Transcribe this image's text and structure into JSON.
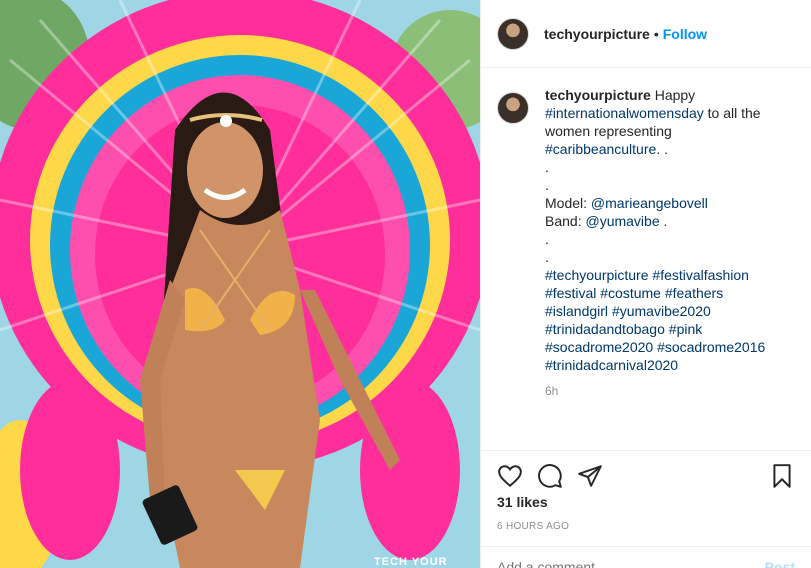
{
  "header": {
    "username": "techyourpicture",
    "dot": "•",
    "follow_label": "Follow"
  },
  "caption": {
    "username": "techyourpicture",
    "first_word": "Happy",
    "tag_womensday": "#internationalwomensday",
    "text_after_womensday": " to all the",
    "line_women": "women representing",
    "tag_culture": "#caribbeanculture",
    "after_culture": ". .",
    "dot1": ".",
    "dot2": ".",
    "model_label": "Model: ",
    "model_handle": "@marieangebovell",
    "band_label": "Band: ",
    "band_handle": "@yumavibe",
    "band_after": " .",
    "dot3": ".",
    "dot4": ".",
    "hashtags": [
      [
        "#techyourpicture",
        "#festivalfashion"
      ],
      [
        "#festival",
        "#costume",
        "#feathers"
      ],
      [
        "#islandgirl",
        "#yumavibe2020"
      ],
      [
        "#trinidadandtobago",
        "#pink"
      ],
      [
        "#socadrome2020",
        "#socadrome2016"
      ],
      [
        "#trinidadcarnival2020"
      ]
    ],
    "time_ago": "6h"
  },
  "likes": "31 likes",
  "timestamp": "6 HOURS AGO",
  "comment_box": {
    "placeholder": "Add a comment...",
    "post_label": "Post"
  },
  "photo": {
    "watermark": "TECH YOUR",
    "description_colors": {
      "feathers_primary": "#ff2e9a",
      "feathers_secondary": "#1aa7d8",
      "feathers_accent": "#ffd84a"
    }
  },
  "colors": {
    "link": "#0095f6",
    "hashtag": "#00376b",
    "muted": "#8e8e8e",
    "border": "#efefef"
  },
  "icons": [
    "heart-icon",
    "comment-icon",
    "share-icon",
    "bookmark-icon"
  ]
}
